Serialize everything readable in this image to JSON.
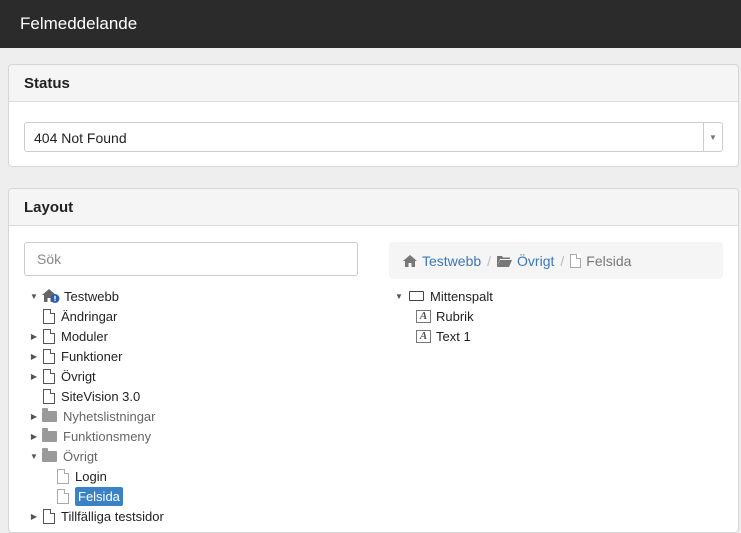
{
  "window": {
    "title": "Felmeddelande"
  },
  "status": {
    "heading": "Status",
    "selected": "404 Not Found"
  },
  "layout": {
    "heading": "Layout",
    "search_placeholder": "Sök",
    "tree": [
      {
        "label": "Testwebb",
        "icon": "home-icon",
        "toggle": "expanded",
        "indent": 0
      },
      {
        "label": "Ändringar",
        "icon": "page-icon",
        "toggle": "none",
        "indent": 1
      },
      {
        "label": "Moduler",
        "icon": "page-icon",
        "toggle": "collapsed",
        "indent": 1
      },
      {
        "label": "Funktioner",
        "icon": "page-icon",
        "toggle": "collapsed",
        "indent": 1
      },
      {
        "label": "Övrigt",
        "icon": "page-icon",
        "toggle": "collapsed",
        "indent": 1
      },
      {
        "label": "SiteVision 3.0",
        "icon": "page-icon",
        "toggle": "none",
        "indent": 1
      },
      {
        "label": "Nyhetslistningar",
        "icon": "folder-icon",
        "toggle": "collapsed",
        "indent": 1,
        "muted": true
      },
      {
        "label": "Funktionsmeny",
        "icon": "folder-icon",
        "toggle": "collapsed",
        "indent": 1,
        "muted": true
      },
      {
        "label": "Övrigt",
        "icon": "folder-icon",
        "toggle": "expanded",
        "indent": 1,
        "muted": true
      },
      {
        "label": "Login",
        "icon": "page-icon-light",
        "toggle": "none",
        "indent": 2
      },
      {
        "label": "Felsida",
        "icon": "page-icon-light",
        "toggle": "none",
        "indent": 2,
        "selected": true
      },
      {
        "label": "Tillfälliga testsidor",
        "icon": "page-icon",
        "toggle": "collapsed",
        "indent": 1
      }
    ],
    "breadcrumb": {
      "items": [
        "Testwebb",
        "Övrigt"
      ],
      "current": "Felsida",
      "separator": "/"
    },
    "page_tree": {
      "root": "Mittenspalt",
      "children": [
        "Rubrik",
        "Text 1"
      ]
    }
  },
  "colors": {
    "accent": "#3b82c4",
    "titlebar": "#2b2b2b",
    "link": "#3b78b8"
  }
}
